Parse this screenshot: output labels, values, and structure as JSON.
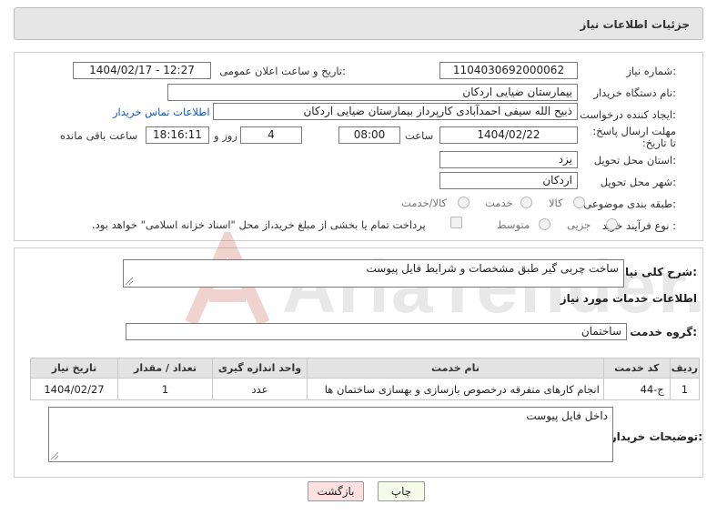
{
  "header": {
    "title": "جزئیات اطلاعات نیاز"
  },
  "form": {
    "need_number_label": "شماره نیاز:",
    "need_number": "1104030692000062",
    "announce_label": "تاریخ و ساعت اعلان عمومی:",
    "announce_value": "1404/02/17 - 12:27",
    "buyer_org_label": "نام دستگاه خریدار:",
    "buyer_org": "بیمارستان ضیایی اردکان",
    "requester_label": "ایجاد کننده درخواست:",
    "requester": "ذبیح الله سیفی احمدآبادی کارپرداز بیمارستان ضیایی اردکان",
    "contact_link": "اطلاعات تماس خریدار",
    "deadline_label": "مهلت ارسال پاسخ: تا تاریخ:",
    "deadline_date": "1404/02/22",
    "time_label": "ساعت",
    "deadline_time": "08:00",
    "days_value": "4",
    "days_label": "روز و",
    "remaining_time": "18:16:11",
    "remaining_label": "ساعت باقی مانده",
    "province_label": "استان محل تحویل:",
    "province": "یزد",
    "city_label": "شهر محل تحویل:",
    "city": "اردکان",
    "category_label": "طبقه بندی موضوعی:",
    "category_options": [
      "کالا",
      "خدمت",
      "کالا/خدمت"
    ],
    "purchase_type_label": "نوع فرآیند خرید :",
    "purchase_options": [
      "جزیی",
      "متوسط"
    ],
    "payment_note": "پرداخت تمام یا بخشی از مبلغ خرید،از محل \"اسناد خزانه اسلامی\" خواهد بود."
  },
  "details": {
    "summary_label": "شرح کلی نیاز:",
    "summary": "ساخت چربی گیر طبق مشخصات و شرایط فایل پیوست",
    "services_title": "اطلاعات خدمات مورد نیاز",
    "service_group_label": "گروه خدمت:",
    "service_group": "ساختمان"
  },
  "table": {
    "headers": [
      "ردیف",
      "کد خدمت",
      "نام خدمت",
      "واحد اندازه گیری",
      "تعداد / مقدار",
      "تاریخ نیاز"
    ],
    "rows": [
      [
        "1",
        "ج-44",
        "انجام کارهای متفرقه درخصوص بازسازی و بهسازی ساختمان ها",
        "عدد",
        "1",
        "1404/02/27"
      ]
    ]
  },
  "buyer_notes": {
    "label": "توضیحات خریدار:",
    "text": "داخل فایل پیوست"
  },
  "buttons": {
    "print": "چاپ",
    "back": "بازگشت"
  },
  "watermark": {
    "text": "AriaTender.neT"
  },
  "colors": {
    "link": "#1a57c6",
    "back_button": "#fde0e0",
    "print_button": "#f4fbe9"
  }
}
